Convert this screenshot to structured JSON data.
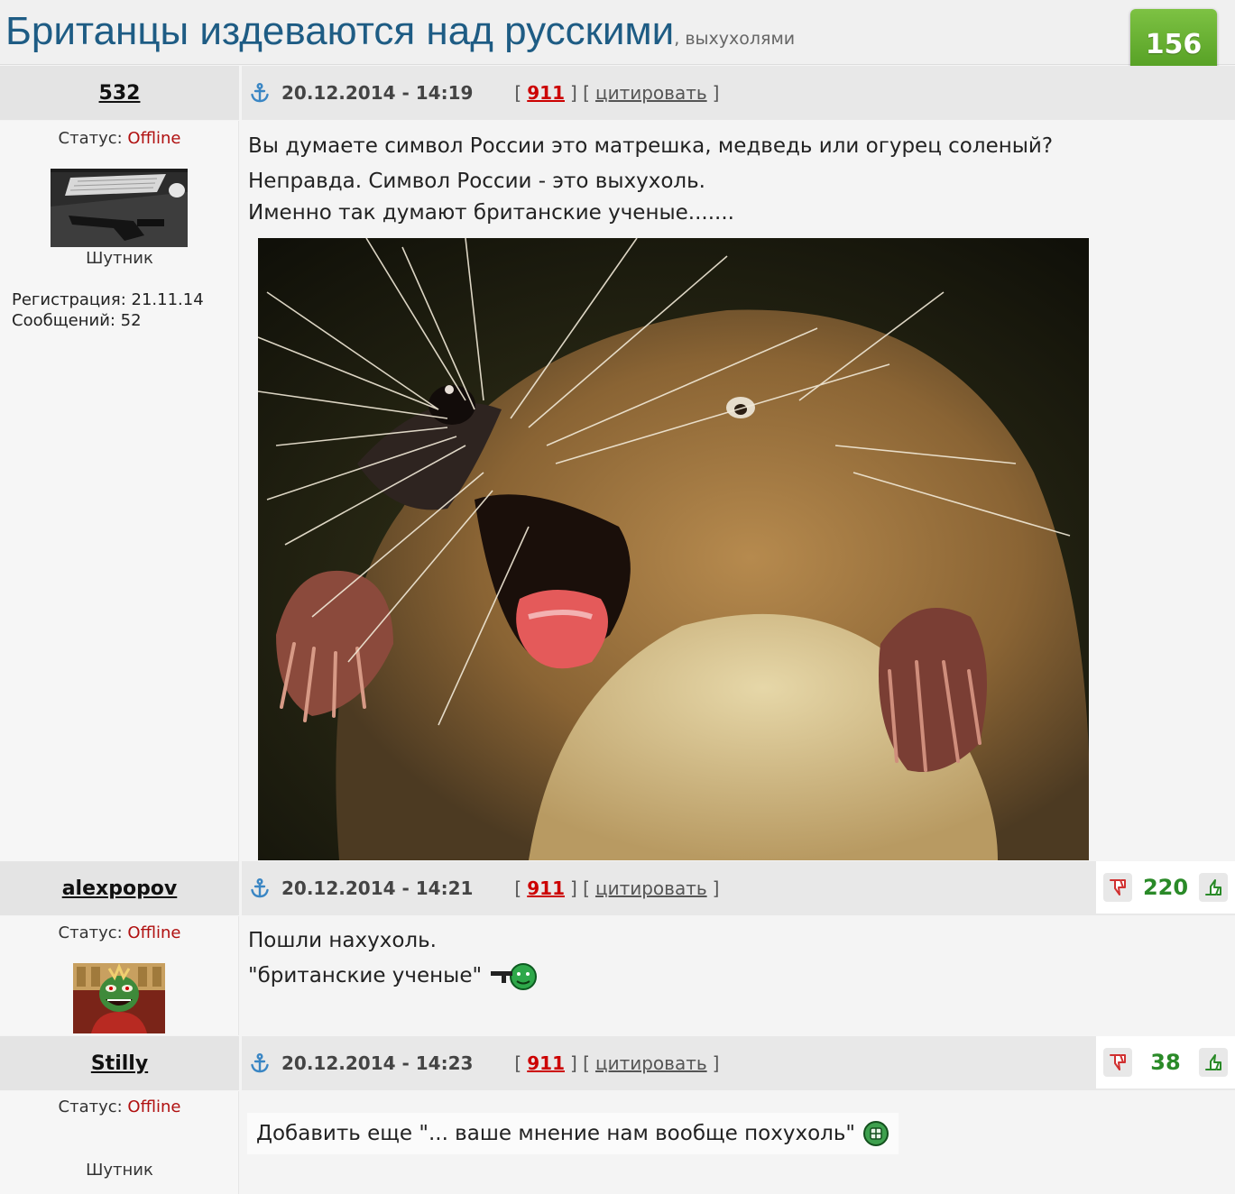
{
  "topic": {
    "title": "Британцы издеваются над русскими",
    "subtitle": ", выхухолями",
    "rating": "156",
    "minus_label": "−",
    "plus_label": "+"
  },
  "posts": [
    {
      "username": "532",
      "date": "20.12.2014 - 14:19",
      "report_label": "911",
      "quote_label": "цитировать",
      "status_label": "Статус: ",
      "status_value": "Offline",
      "rank": "Шутник",
      "registration": "Регистрация: 21.11.14",
      "messages": "Сообщений: 52",
      "text_lines": [
        "Вы думаете символ России это матрешка, медведь или огурец соленый?",
        "Неправда. Символ России - это выхухоль.",
        "Именно так думают британские ученые......."
      ]
    },
    {
      "username": "alexpopov",
      "date": "20.12.2014 - 14:21",
      "report_label": "911",
      "quote_label": "цитировать",
      "status_label": "Статус: ",
      "status_value": "Offline",
      "votes": "220",
      "text_lines": [
        "Пошли нахухоль.",
        "\"британские ученые\""
      ]
    },
    {
      "username": "Stilly",
      "date": "20.12.2014 - 14:23",
      "report_label": "911",
      "quote_label": "цитировать",
      "status_label": "Статус: ",
      "status_value": "Offline",
      "rank": "Шутник",
      "votes": "38",
      "text_lines": [
        "Добавить еще \"... ваше мнение нам вообще похухоль\""
      ]
    }
  ],
  "bracket_open": "[",
  "bracket_close": "]",
  "colors": {
    "title": "#1e5c84",
    "offline": "#b01010",
    "report_link": "#cc0000",
    "vote_positive": "#2a8a28"
  }
}
